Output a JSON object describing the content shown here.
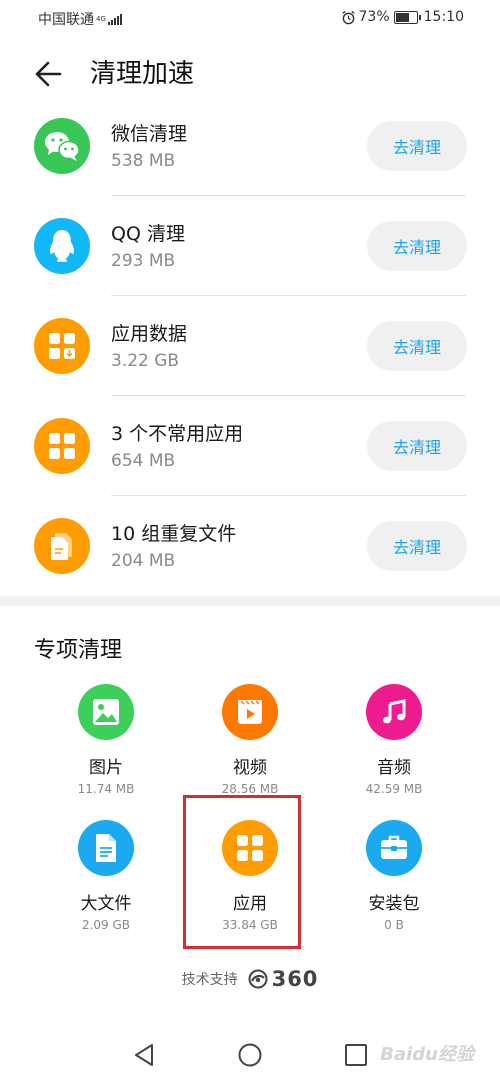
{
  "status_bar": {
    "carrier": "中国联通",
    "network": "4G",
    "battery": "73%",
    "battery_level": 0.73,
    "time": "15:10"
  },
  "header": {
    "title": "清理加速"
  },
  "clean_items": [
    {
      "title": "微信清理",
      "size": "538 MB",
      "button": "去清理",
      "icon": "wechat-icon",
      "color": "#38c756"
    },
    {
      "title": "QQ 清理",
      "size": "293 MB",
      "button": "去清理",
      "icon": "qq-penguin-icon",
      "color": "#12b7f5"
    },
    {
      "title": "应用数据",
      "size": "3.22 GB",
      "button": "去清理",
      "icon": "app-data-icon",
      "color": "#ff9d00"
    },
    {
      "title": "3 个不常用应用",
      "size": "654 MB",
      "button": "去清理",
      "icon": "unused-apps-icon",
      "color": "#ff9d00"
    },
    {
      "title": "10 组重复文件",
      "size": "204 MB",
      "button": "去清理",
      "icon": "duplicate-files-icon",
      "color": "#ff9d00"
    }
  ],
  "special_section": {
    "title": "专项清理",
    "items": [
      {
        "label": "图片",
        "size": "11.74 MB",
        "icon": "image-icon",
        "color": "#3ecf5a"
      },
      {
        "label": "视频",
        "size": "28.56 MB",
        "icon": "video-icon",
        "color": "#ff7800"
      },
      {
        "label": "音频",
        "size": "42.59 MB",
        "icon": "music-note-icon",
        "color": "#ee1b8e"
      },
      {
        "label": "大文件",
        "size": "2.09 GB",
        "icon": "document-icon",
        "color": "#1ba9f0"
      },
      {
        "label": "应用",
        "size": "33.84 GB",
        "icon": "apps-grid-icon",
        "color": "#ff9d00"
      },
      {
        "label": "安装包",
        "size": "0 B",
        "icon": "toolbox-icon",
        "color": "#1ba9f0"
      }
    ]
  },
  "footer": {
    "support_label": "技术支持",
    "brand": "360"
  },
  "nav": {
    "back": "back-triangle-icon",
    "home": "home-circle-icon",
    "recents": "recents-square-icon"
  },
  "highlight_color": "#d32f2f"
}
